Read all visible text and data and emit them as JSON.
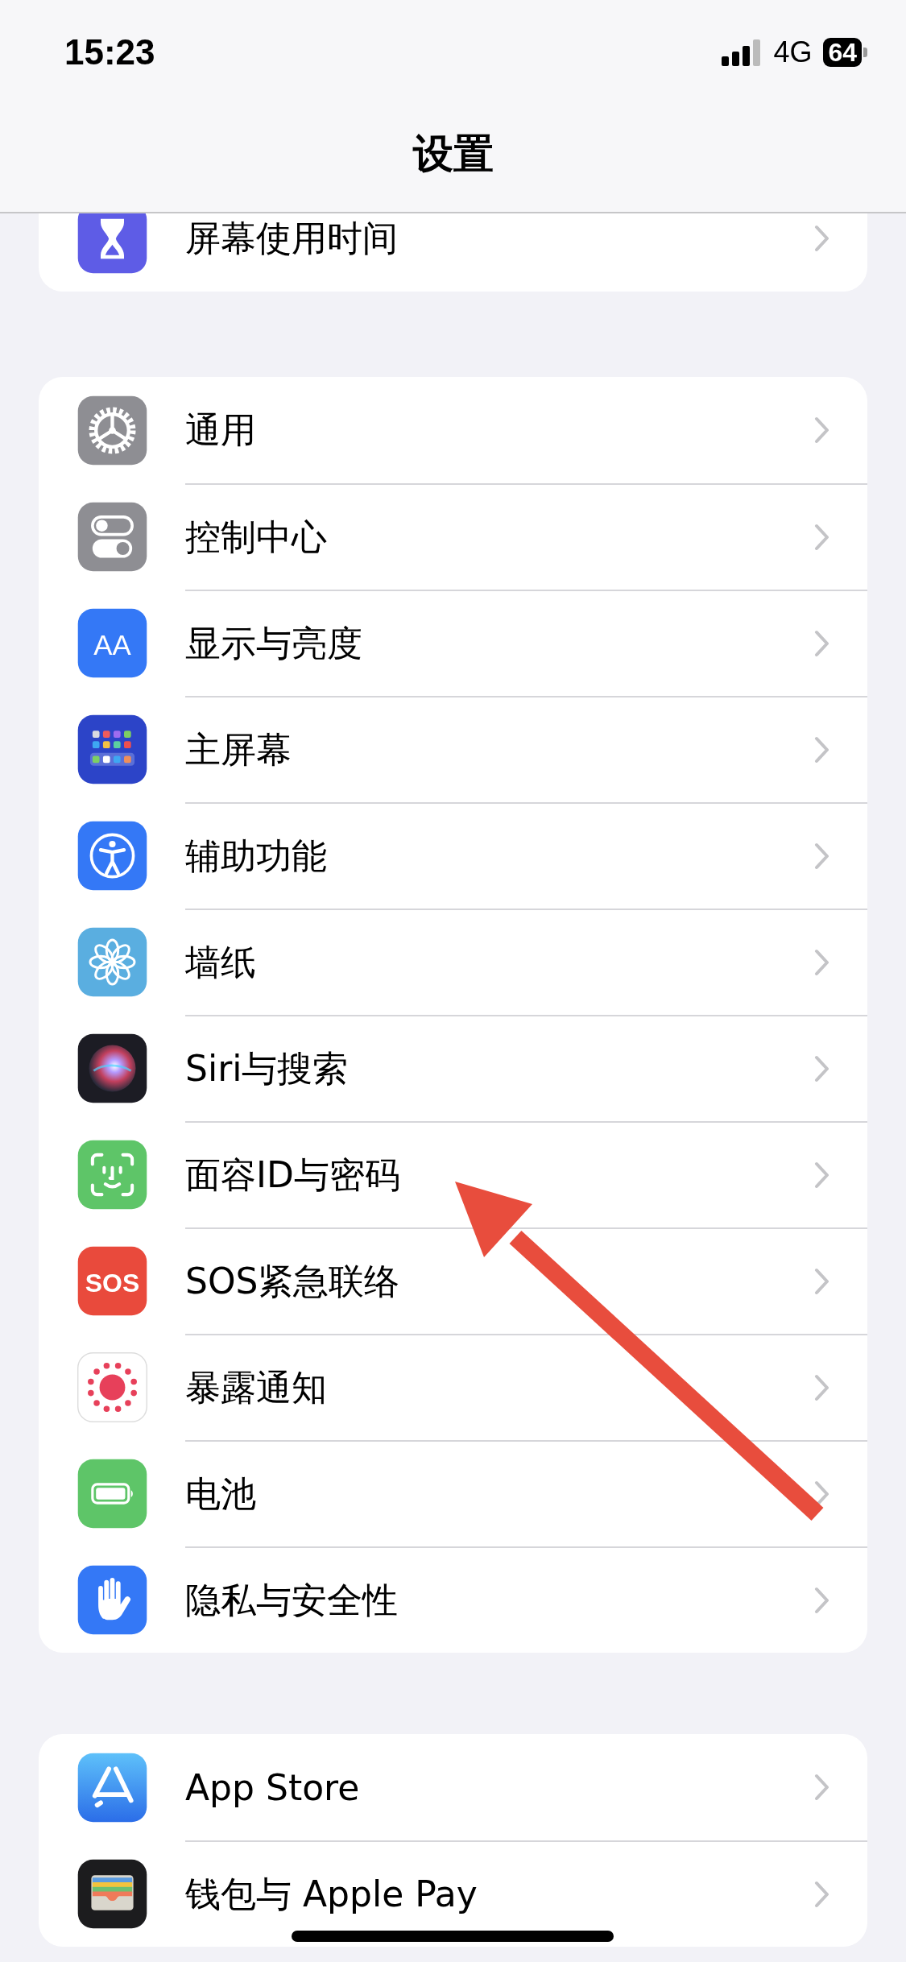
{
  "status_bar": {
    "time": "15:23",
    "network": "4G",
    "battery": "64"
  },
  "nav_bar": {
    "title": "设置"
  },
  "groups": [
    {
      "clipped": true,
      "items": [
        {
          "label": "屏幕使用时间",
          "kind": "hourglass"
        }
      ]
    },
    {
      "clipped": false,
      "items": [
        {
          "label": "通用",
          "kind": "gear"
        },
        {
          "label": "控制中心",
          "kind": "switches"
        },
        {
          "label": "显示与亮度",
          "kind": "letters",
          "icon_text": "AA"
        },
        {
          "label": "主屏幕",
          "kind": "grid"
        },
        {
          "label": "辅助功能",
          "kind": "figure"
        },
        {
          "label": "墙纸",
          "kind": "flower"
        },
        {
          "label": "Siri与搜索",
          "kind": "orb"
        },
        {
          "label": "面容ID与密码",
          "kind": "face"
        },
        {
          "label": "SOS紧急联络",
          "kind": "letters",
          "icon_text": "SOS"
        },
        {
          "label": "暴露通知",
          "kind": "dots"
        },
        {
          "label": "电池",
          "kind": "battery"
        },
        {
          "label": "隐私与安全性",
          "kind": "hand"
        }
      ]
    },
    {
      "clipped": false,
      "items": [
        {
          "label": "App Store",
          "kind": "store"
        },
        {
          "label": "钱包与 Apple Pay",
          "kind": "wallet"
        }
      ]
    }
  ],
  "annotation": {
    "kind": "arrow"
  }
}
